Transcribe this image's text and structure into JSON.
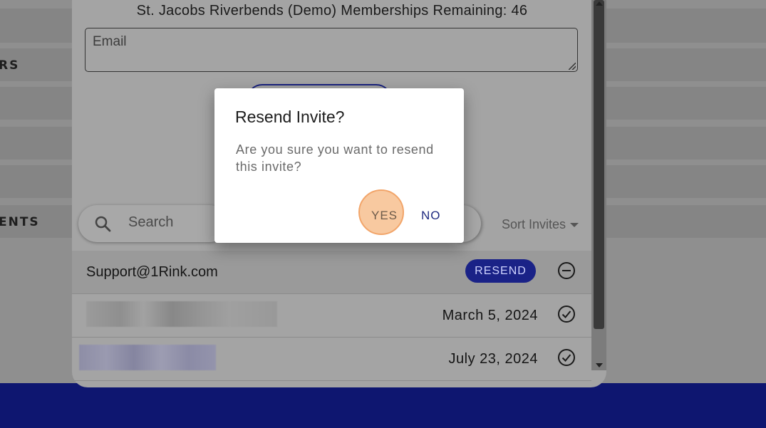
{
  "background": {
    "side_labels": [
      "RS",
      "ENTS"
    ]
  },
  "panel": {
    "title": "St. Jacobs Riverbends (Demo) Memberships Remaining: 46",
    "email_placeholder": "Email",
    "search_placeholder": "Search",
    "sort_label": "Sort Invites"
  },
  "invites": [
    {
      "email": "Support@1Rink.com",
      "status_label": "RESEND",
      "status_icon": "minus-circle-icon"
    },
    {
      "email": "",
      "date": "March 5, 2024",
      "status_icon": "check-circle-icon"
    },
    {
      "email": "",
      "date": "July 23, 2024",
      "status_icon": "check-circle-icon"
    }
  ],
  "dialog": {
    "title": "Resend Invite?",
    "message": "Are you sure you want to resend this invite?",
    "yes_label": "YES",
    "no_label": "NO"
  },
  "colors": {
    "brand_blue": "#1a2287",
    "bottom_bar": "#0e1670",
    "click_highlight": "#f8c9a0"
  }
}
